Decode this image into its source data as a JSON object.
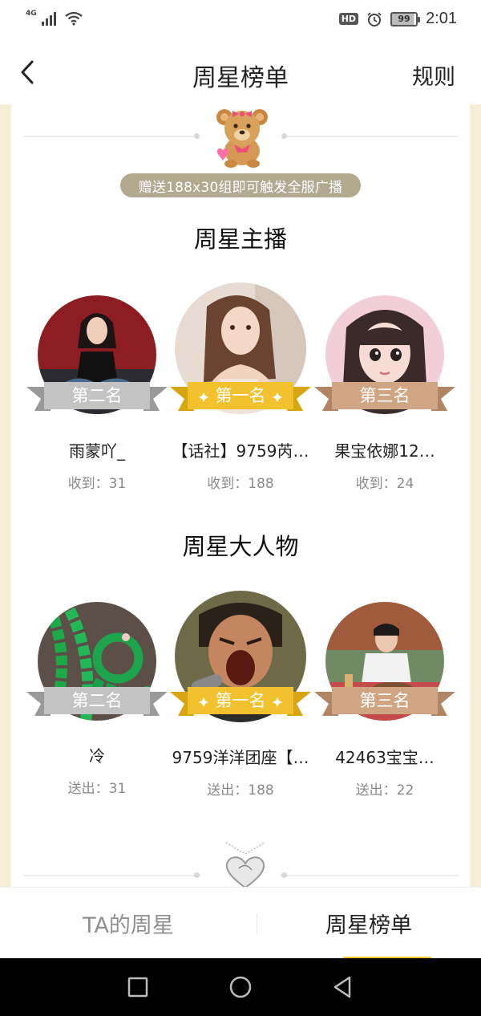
{
  "status_bar": {
    "network": "4G",
    "hd_label": "HD",
    "battery": "99",
    "time": "2:01"
  },
  "header": {
    "title": "周星榜单",
    "rules_label": "规则"
  },
  "broadcast_text": "赠送188x30组即可触发全服广播",
  "hosts": {
    "title": "周星主播",
    "items": [
      {
        "rank_label": "第二名",
        "name": "雨蒙吖_",
        "stat": "收到：31"
      },
      {
        "rank_label": "第一名",
        "name": "【话社】9759芮…",
        "stat": "收到：188"
      },
      {
        "rank_label": "第三名",
        "name": "果宝依娜12…",
        "stat": "收到：24"
      }
    ]
  },
  "vips": {
    "title": "周星大人物",
    "items": [
      {
        "rank_label": "第二名",
        "name": "冷",
        "stat": "送出：31"
      },
      {
        "rank_label": "第一名",
        "name": "9759洋洋团座【…",
        "stat": "送出：188"
      },
      {
        "rank_label": "第三名",
        "name": "42463宝宝…",
        "stat": "送出：22"
      }
    ]
  },
  "tabs": [
    {
      "label": "TA的周星",
      "active": false
    },
    {
      "label": "周星榜单",
      "active": true
    }
  ],
  "colors": {
    "gold": "#f2c12e",
    "silver": "#c3c3c3",
    "bronze": "#cfa584",
    "cream": "#f6edd6",
    "tab_accent": "#f0c42a"
  }
}
